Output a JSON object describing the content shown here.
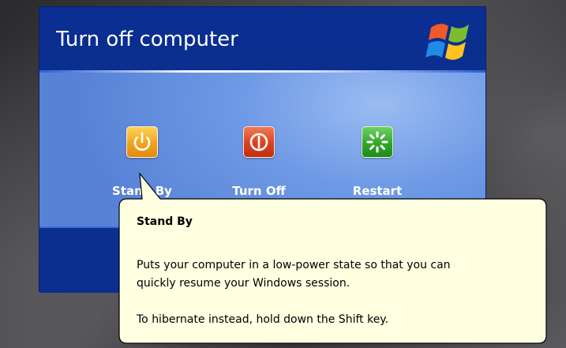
{
  "dialog": {
    "title": "Turn off computer",
    "logo_icon": "windows-xp-flag-icon",
    "colors": {
      "header": "#0b2f8f",
      "body": "#6f9ae5",
      "footer": "#0b2f8f",
      "tooltip_bg": "#ffffe1"
    },
    "actions": [
      {
        "label": "Stand By",
        "icon": "power-standby-icon",
        "color": "#f2a31c"
      },
      {
        "label": "Turn Off",
        "icon": "power-off-icon",
        "color": "#d9421f"
      },
      {
        "label": "Restart",
        "icon": "restart-icon",
        "color": "#33a62a"
      }
    ]
  },
  "tooltip": {
    "title": "Stand By",
    "line1": "Puts your computer in a low-power state so that you can",
    "line2": "quickly resume your Windows session.",
    "line3": "To hibernate instead, hold down the Shift key."
  }
}
